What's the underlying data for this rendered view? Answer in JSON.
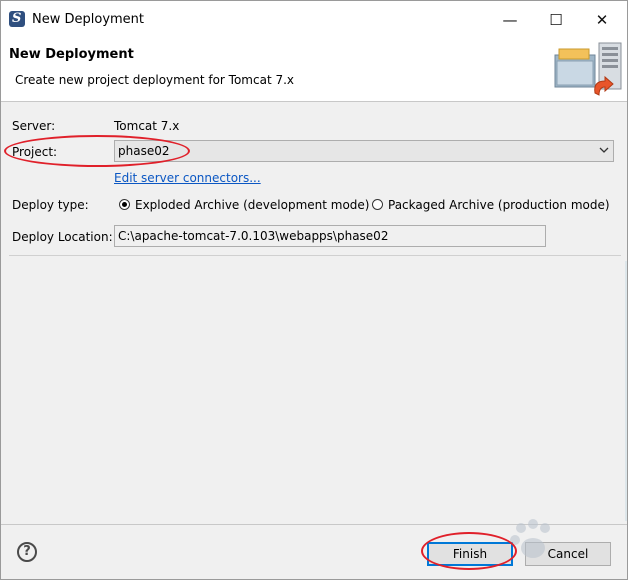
{
  "window": {
    "title": "New Deployment",
    "minimize": "—",
    "maximize": "☐",
    "close": "✕"
  },
  "banner": {
    "title": "New Deployment",
    "description": "Create new project deployment for Tomcat  7.x"
  },
  "form": {
    "server_label": "Server:",
    "server_value": "Tomcat  7.x",
    "project_label": "Project:",
    "project_value": "phase02",
    "edit_connectors_link": "Edit server connectors...",
    "deploy_type_label": "Deploy type:",
    "deploy_type_options": [
      {
        "label": "Exploded Archive (development mode)",
        "selected": true
      },
      {
        "label": "Packaged Archive (production mode)",
        "selected": false
      }
    ],
    "deploy_location_label": "Deploy Location:",
    "deploy_location_value": "C:\\apache-tomcat-7.0.103\\webapps\\phase02"
  },
  "footer": {
    "help": "?",
    "finish_label": "Finish",
    "cancel_label": "Cancel"
  },
  "icons": {
    "app": "eclipse-s-icon",
    "banner": "server-deploy-icon"
  },
  "colors": {
    "annotation": "#e0202a",
    "link": "#0b57c3",
    "default_button_border": "#0078d7"
  }
}
